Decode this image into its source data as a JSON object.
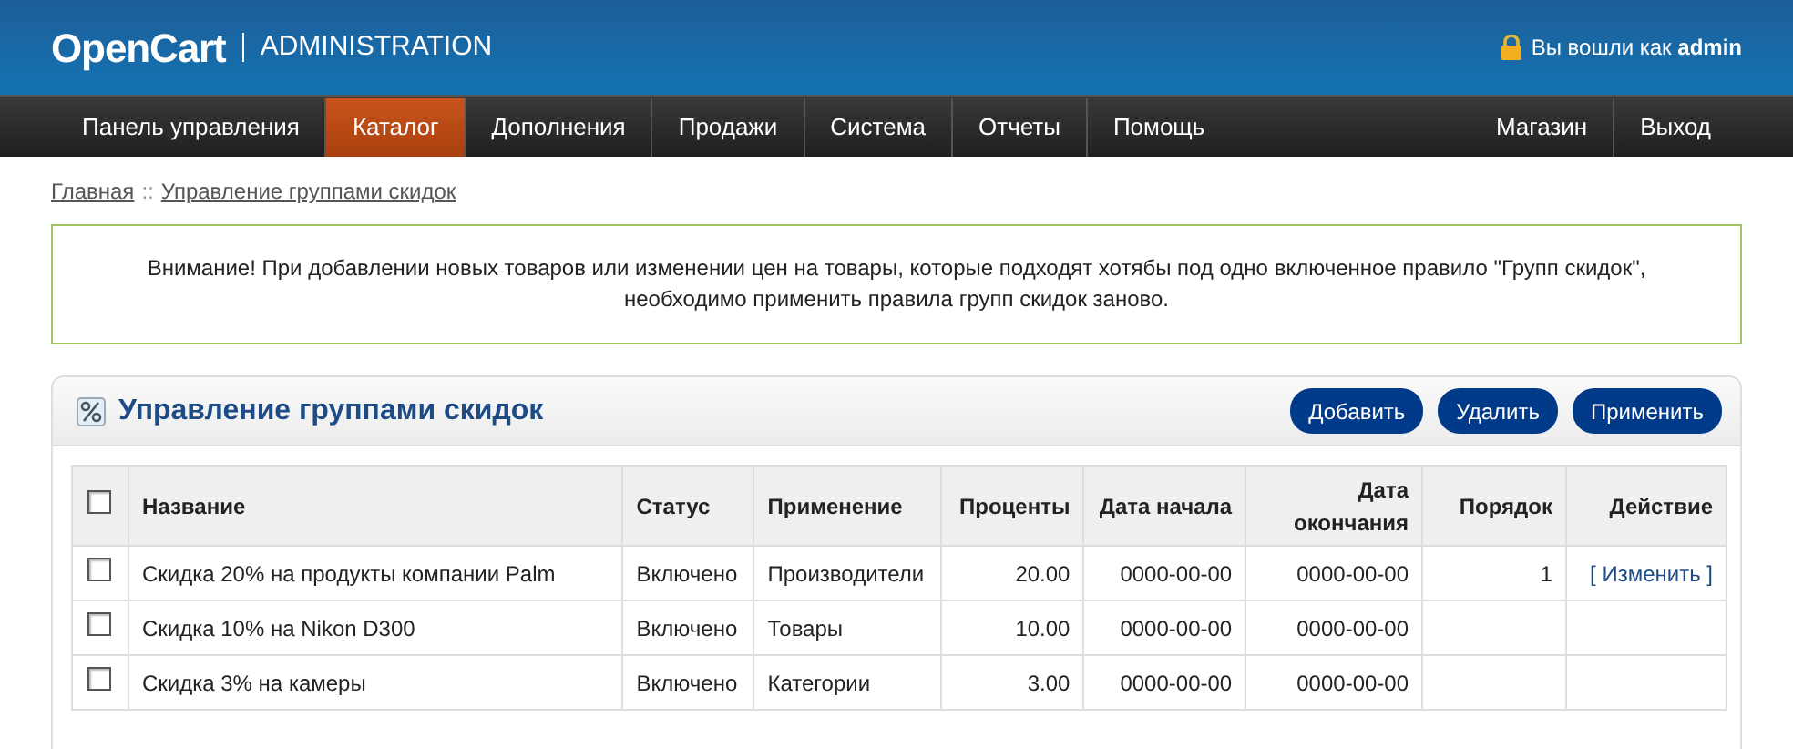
{
  "header": {
    "logo": "OpenCart",
    "subtitle": "ADMINISTRATION",
    "login_text": "Вы вошли как",
    "user": "admin"
  },
  "nav": {
    "left": [
      {
        "label": "Панель управления",
        "selected": false
      },
      {
        "label": "Каталог",
        "selected": true
      },
      {
        "label": "Дополнения",
        "selected": false
      },
      {
        "label": "Продажи",
        "selected": false
      },
      {
        "label": "Система",
        "selected": false
      },
      {
        "label": "Отчеты",
        "selected": false
      },
      {
        "label": "Помощь",
        "selected": false
      }
    ],
    "right": [
      {
        "label": "Магазин",
        "selected": false
      },
      {
        "label": "Выход",
        "selected": false
      }
    ]
  },
  "breadcrumb": {
    "items": [
      "Главная",
      "Управление группами скидок"
    ],
    "separator": "::"
  },
  "warning": "Внимание! При добавлении новых товаров или изменении цен на товары, которые подходят хотябы под одно включенное правило \"Групп скидок\", необходимо применить правила групп скидок заново.",
  "panel": {
    "title": "Управление группами скидок",
    "buttons": [
      "Добавить",
      "Удалить",
      "Применить"
    ]
  },
  "table": {
    "select_all_checked": false,
    "columns": [
      "Название",
      "Статус",
      "Применение",
      "Проценты",
      "Дата начала",
      "Дата окончания",
      "Порядок",
      "Действие"
    ],
    "rows": [
      {
        "checked": false,
        "name": "Скидка 20% на продукты компании Palm",
        "status": "Включено",
        "applies_to": "Производители",
        "percent": "20.00",
        "start": "0000-00-00",
        "end": "0000-00-00",
        "order": "1",
        "action": "[ Изменить ]"
      },
      {
        "checked": false,
        "name": "Скидка 10% на Nikon D300",
        "status": "Включено",
        "applies_to": "Товары",
        "percent": "10.00",
        "start": "0000-00-00",
        "end": "0000-00-00"
      },
      {
        "checked": false,
        "name": "Скидка 3% на камеры",
        "status": "Включено",
        "applies_to": "Категории",
        "percent": "3.00",
        "start": "0000-00-00",
        "end": "0000-00-00"
      }
    ]
  }
}
